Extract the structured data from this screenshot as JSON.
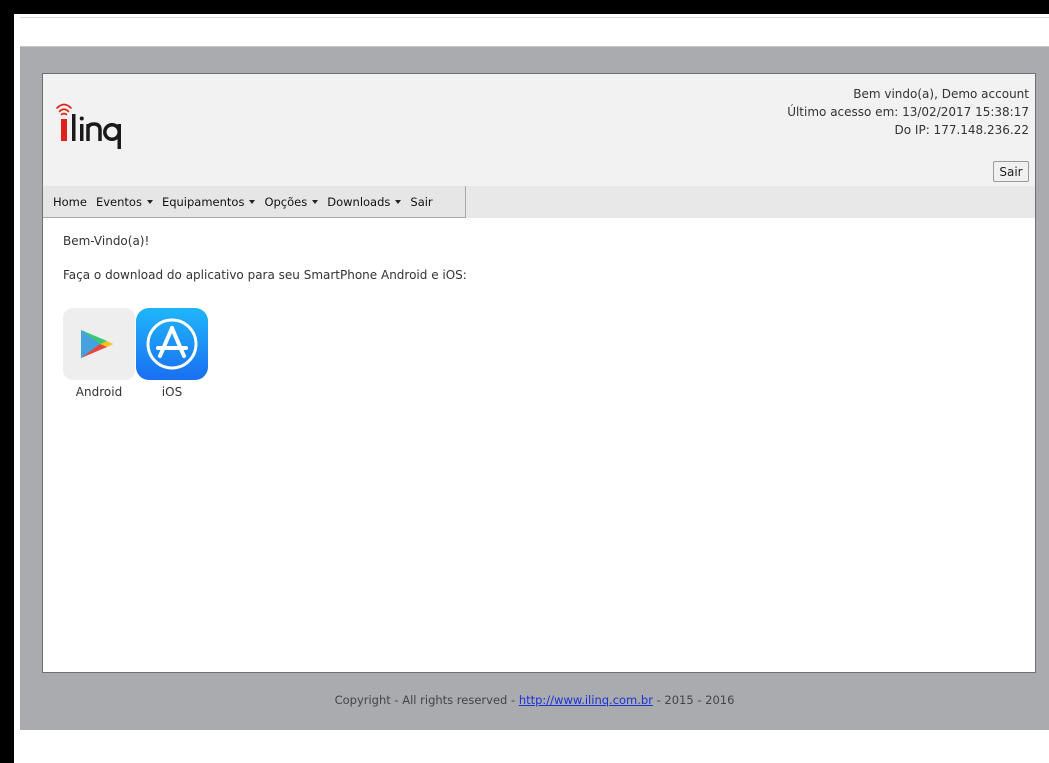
{
  "header": {
    "logo_text": "iLinq",
    "welcome_line": "Bem vindo(a), Demo account",
    "last_access_line": "Último acesso em: 13/02/2017 15:38:17",
    "ip_line": "Do IP: 177.148.236.22",
    "logout_button": "Sair"
  },
  "nav": {
    "items": [
      {
        "label": "Home",
        "dropdown": false
      },
      {
        "label": "Eventos",
        "dropdown": true
      },
      {
        "label": "Equipamentos",
        "dropdown": true
      },
      {
        "label": "Opções",
        "dropdown": true
      },
      {
        "label": "Downloads",
        "dropdown": true
      },
      {
        "label": "Sair",
        "dropdown": false
      }
    ]
  },
  "content": {
    "welcome": "Bem-Vindo(a)!",
    "download_prompt": "Faça o download do aplicativo para seu SmartPhone Android e iOS:",
    "apps": [
      {
        "label": "Android",
        "icon": "google-play-icon"
      },
      {
        "label": "iOS",
        "icon": "app-store-icon"
      }
    ]
  },
  "footer": {
    "prefix": "Copyright - All rights reserved - ",
    "link": "http://www.ilinq.com.br",
    "suffix": " - 2015 - 2016"
  },
  "colors": {
    "logo_red": "#e0201b",
    "background_gray": "#a9abae",
    "header_bg": "#f2f2f2",
    "link_blue": "#1a33d6",
    "app_store_blue": "#1d8cf8"
  }
}
